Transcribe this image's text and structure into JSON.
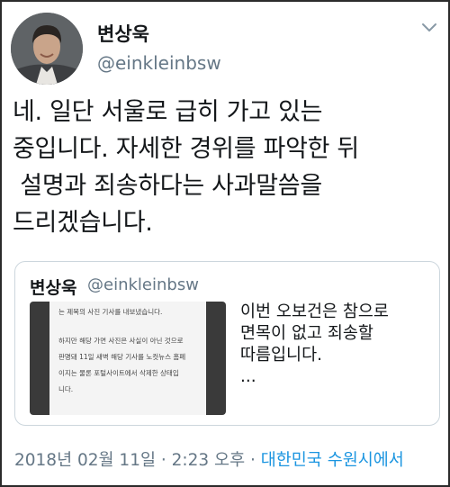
{
  "tweet": {
    "author_name": "변상욱",
    "author_handle": "@einkleinbsw",
    "body_lines": [
      "네. 일단 서울로 급히 가고 있는",
      "중입니다. 자세한 경위를 파악한 뒤",
      " 설명과 죄송하다는 사과말씀을",
      "드리겠습니다."
    ],
    "timestamp": "2018년 02월 11일 · 2:23 오후 ·",
    "location": "대한민국 수원시에서"
  },
  "quoted": {
    "author_name": "변상욱",
    "author_handle": "@einkleinbsw",
    "image_lines": [
      "는 제목의 사진 기사를 내보냈습니다.",
      "하지만 해당 가면 사진은 사실이 아닌 것으로",
      "판명돼 11일 새벽 해당 기사를 노컷뉴스 홈페",
      "이지는 물론 포털사이트에서 삭제한 상태입",
      "니다."
    ],
    "text_lines": [
      "이번 오보건은 참으로",
      "면목이 없고 죄송할",
      "따름입니다.",
      "..."
    ]
  },
  "icons": {
    "menu": "chevron-down-icon",
    "avatar": "profile-photo"
  },
  "colors": {
    "text": "#14171a",
    "secondary": "#657786",
    "link": "#1b95e0",
    "border": "#ccd6dd"
  }
}
